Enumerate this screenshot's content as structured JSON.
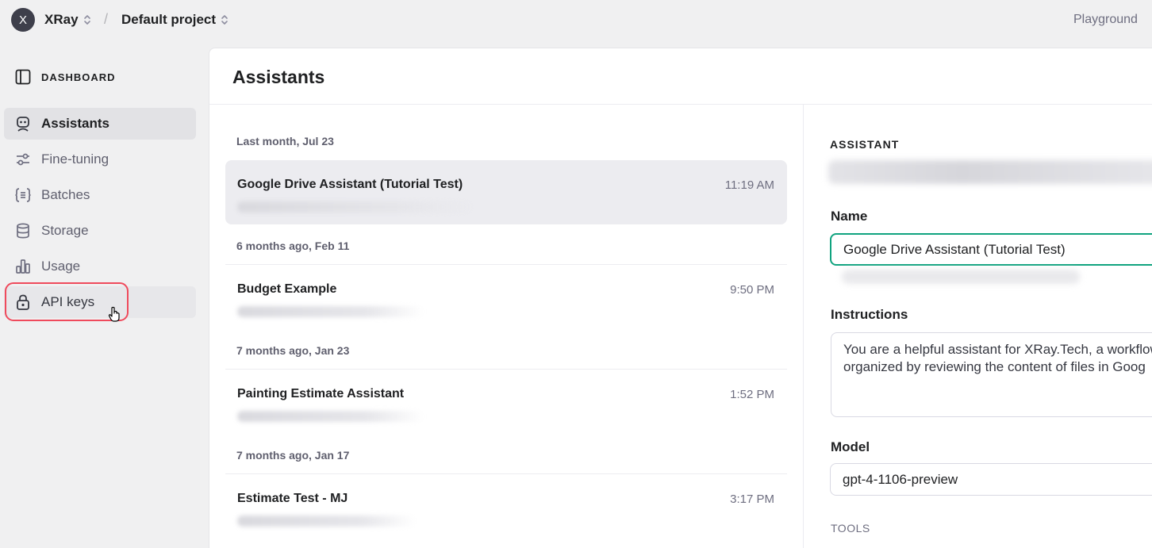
{
  "topbar": {
    "org_initial": "X",
    "org_name": "XRay",
    "separator": "/",
    "project_name": "Default project",
    "playground_label": "Playground"
  },
  "sidebar": {
    "section_label": "DASHBOARD",
    "items": [
      {
        "label": "Assistants",
        "icon": "robot-icon",
        "active": true
      },
      {
        "label": "Fine-tuning",
        "icon": "sliders-icon",
        "active": false
      },
      {
        "label": "Batches",
        "icon": "braces-list-icon",
        "active": false
      },
      {
        "label": "Storage",
        "icon": "database-icon",
        "active": false
      },
      {
        "label": "Usage",
        "icon": "bar-chart-icon",
        "active": false
      },
      {
        "label": "API keys",
        "icon": "lock-icon",
        "active": false,
        "hovered": true
      }
    ]
  },
  "main": {
    "title": "Assistants"
  },
  "assistant_list": {
    "groups": [
      {
        "label": "Last month, Jul 23",
        "items": [
          {
            "name": "Google Drive Assistant (Tutorial Test)",
            "time": "11:19 AM",
            "selected": true
          }
        ]
      },
      {
        "label": "6 months ago, Feb 11",
        "items": [
          {
            "name": "Budget Example",
            "time": "9:50 PM"
          }
        ]
      },
      {
        "label": "7 months ago, Jan 23",
        "items": [
          {
            "name": "Painting Estimate Assistant",
            "time": "1:52 PM"
          }
        ]
      },
      {
        "label": "7 months ago, Jan 17",
        "items": [
          {
            "name": "Estimate Test - MJ",
            "time": "3:17 PM"
          }
        ]
      }
    ]
  },
  "detail": {
    "heading": "ASSISTANT",
    "name_label": "Name",
    "name_value": "Google Drive Assistant (Tutorial Test)",
    "instructions_label": "Instructions",
    "instructions_lines": [
      "You are a helpful assistant for XRay.Tech, a workflow",
      "organized by reviewing the content of files in Goog"
    ],
    "model_label": "Model",
    "model_value": "gpt-4-1106-preview",
    "tools_label": "TOOLS"
  },
  "colors": {
    "accent_green": "#10a37f",
    "highlight_red": "#ef4a5c",
    "sidebar_bg": "#f0f0f1",
    "active_bg": "#e2e2e5"
  }
}
